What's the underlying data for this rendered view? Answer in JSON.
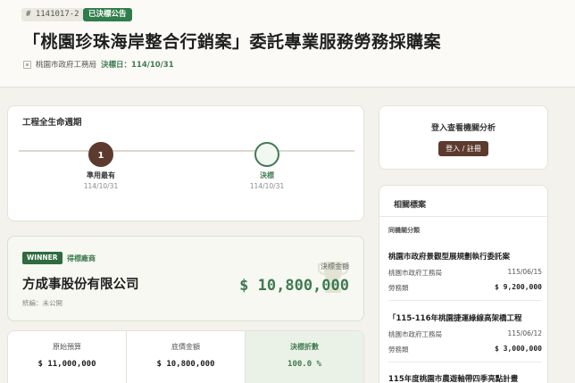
{
  "header": {
    "case_id": "# 1141017-2",
    "status": "已決標公告",
    "title": "「桃園珍珠海岸整合行銷案」委託專業服務勞務採購案",
    "agency": "桃園市政府工務局",
    "decision_date": "決標日：114/10/31"
  },
  "lifecycle": {
    "title": "工程全生命週期",
    "steps": [
      {
        "number": "1",
        "label": "準用最有",
        "date": "114/10/31"
      },
      {
        "number": "",
        "label": "決標",
        "date": "114/10/31"
      }
    ]
  },
  "winner": {
    "badge": "WINNER",
    "role": "得標廠商",
    "name": "方成事股份有限公司",
    "tax_id": "統編：未公開",
    "amount_label": "決標金額",
    "amount": "$ 10,800,000"
  },
  "metrics": [
    {
      "label": "原始預算",
      "value": "$ 11,000,000"
    },
    {
      "label": "底價金額",
      "value": "$ 10,800,000"
    },
    {
      "label": "決標折數",
      "value": "100.0 %"
    }
  ],
  "login": {
    "title": "登入查看機關分析",
    "button": "登入 / 註冊"
  },
  "related": {
    "title": "相關標案",
    "subtitle": "同機關分類",
    "items": [
      {
        "title": "桃園市政府景觀型展規劃執行委託案",
        "agency": "桃園市政府工務局",
        "date": "115/06/15",
        "category": "勞務類",
        "amount": "$ 9,200,000"
      },
      {
        "title": "「115-116年桃園捷運綠線高架橋工程",
        "agency": "桃園市政府工務局",
        "date": "115/06/12",
        "category": "勞務類",
        "amount": "$ 3,000,000"
      },
      {
        "title": "115年度桃園市農遊軸帶四季亮點計畫",
        "agency": "",
        "date": "",
        "category": "",
        "amount": ""
      }
    ]
  },
  "colors": {
    "accent_green": "#3f7a52",
    "accent_brown": "#5c3a2e",
    "background": "#f4f2ed"
  }
}
